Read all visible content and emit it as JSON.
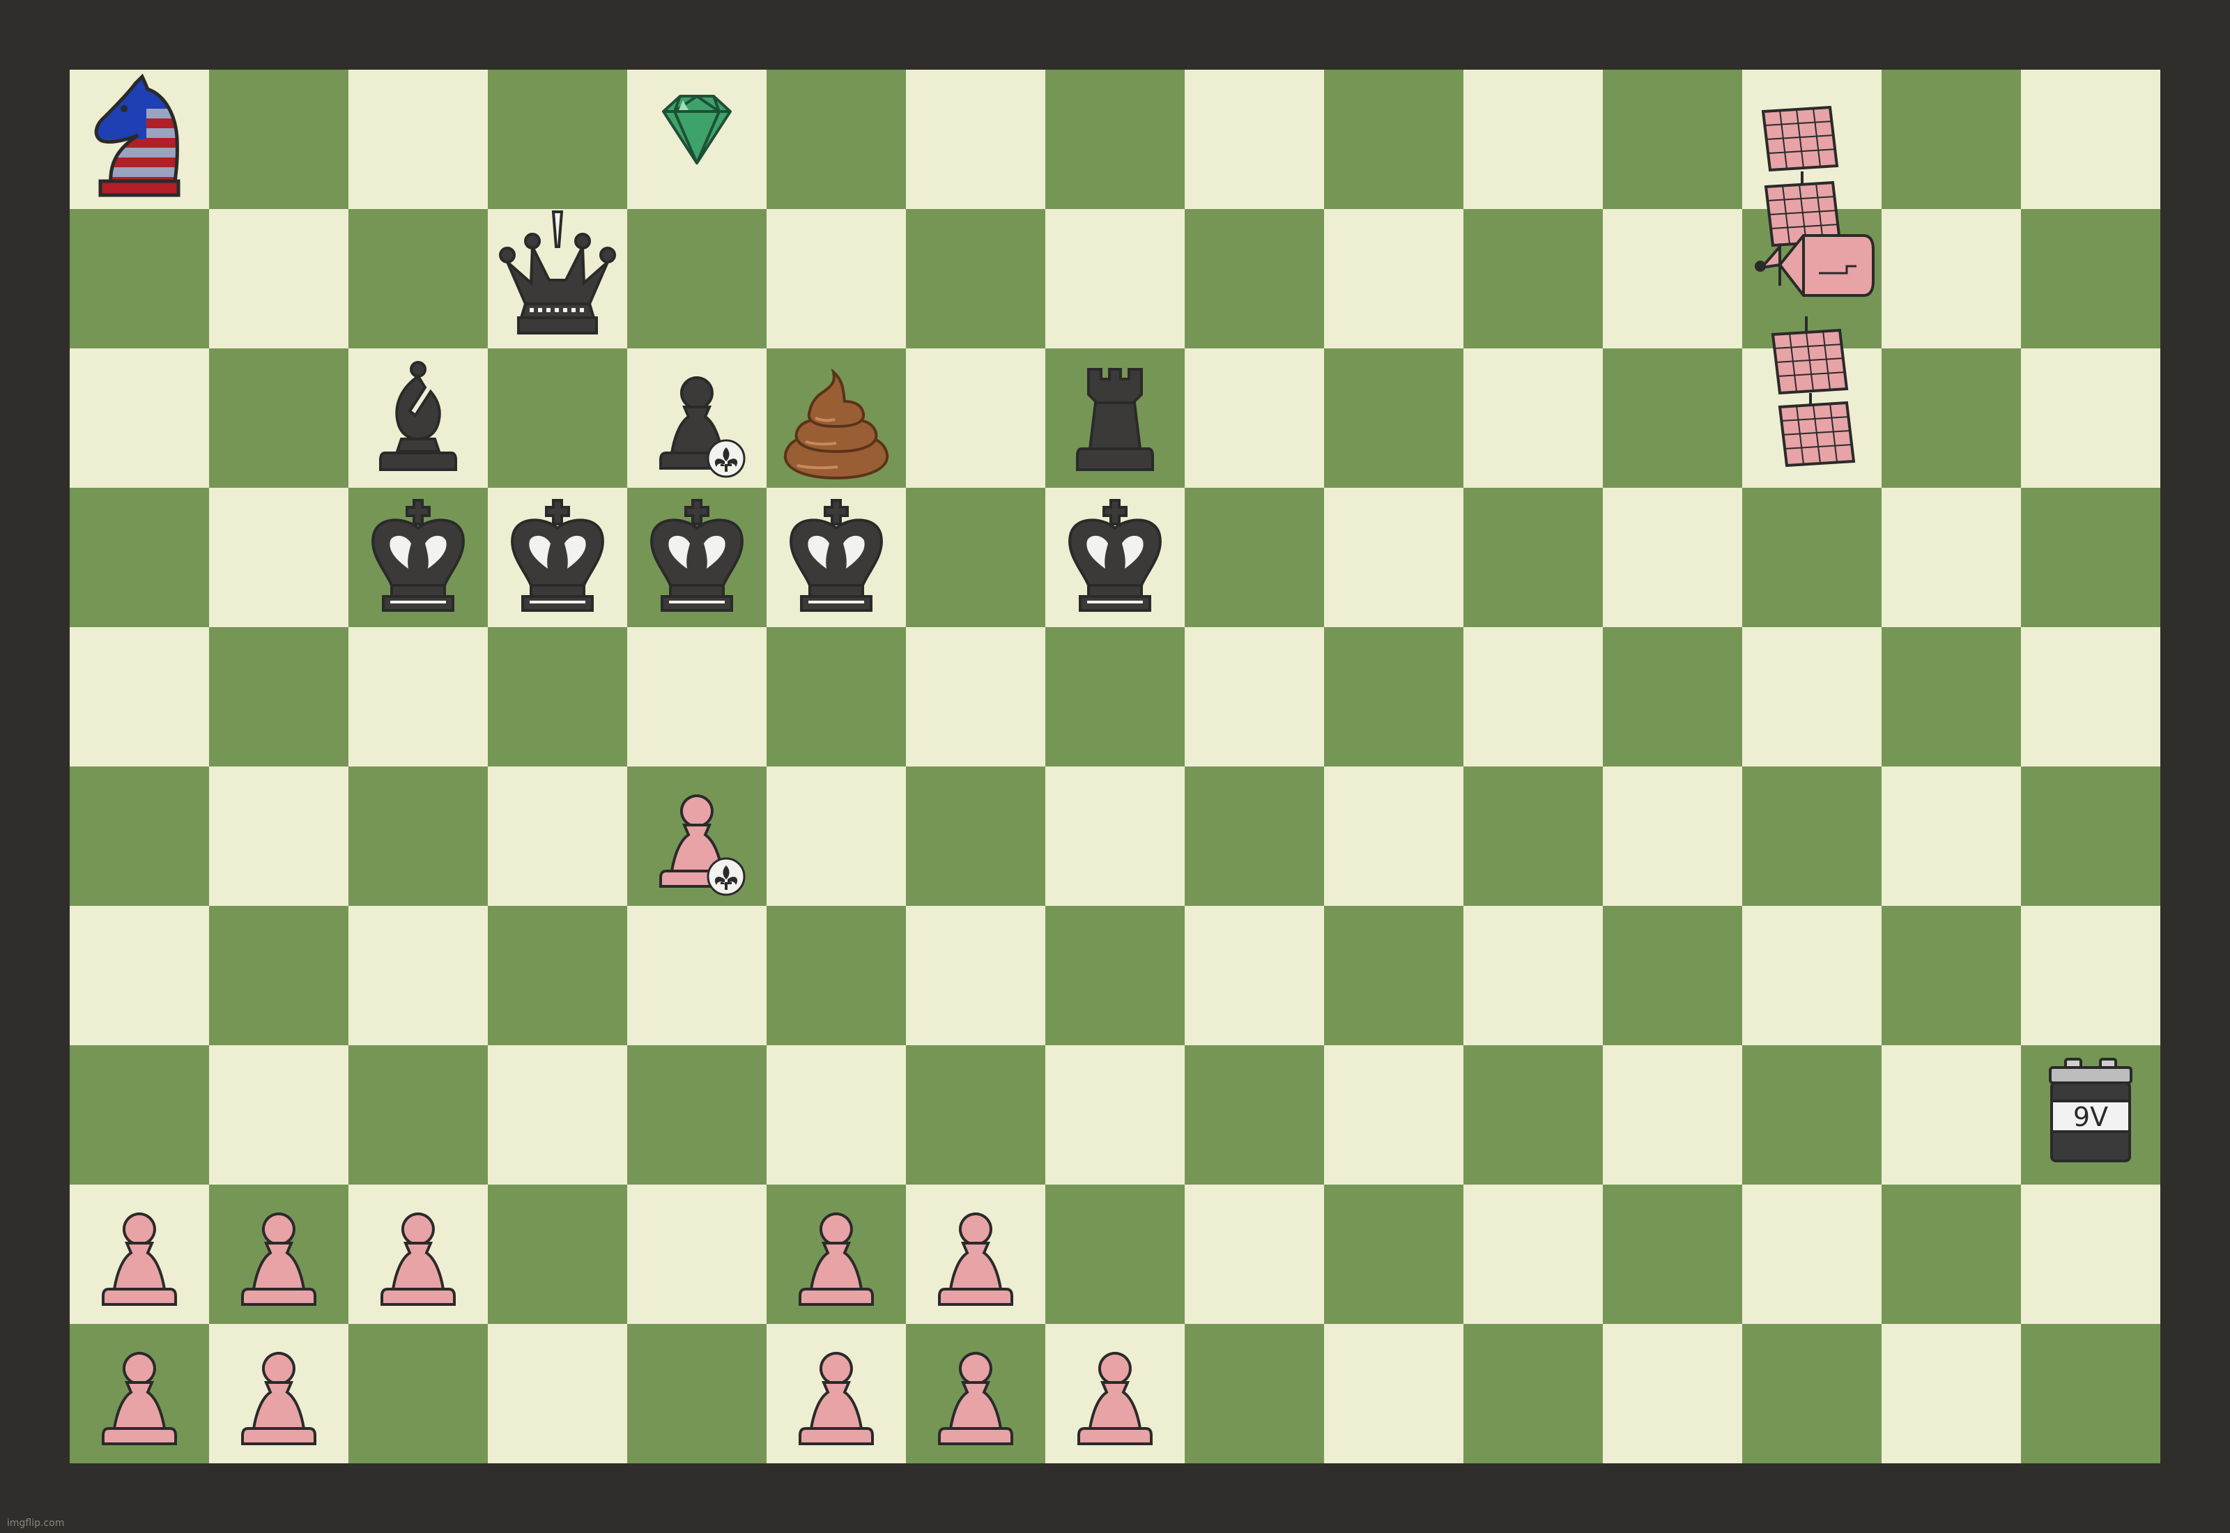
{
  "board": {
    "files": 15,
    "ranks": 10,
    "light_color": "#eeeed2",
    "dark_color": "#769656",
    "first_square_light": true
  },
  "colors": {
    "frame": "#302e2b",
    "black_piece": "#3b3a39",
    "pink_piece": "#e7a3a6",
    "outline": "#2a2a2a"
  },
  "pieces": [
    {
      "name": "knight-american-flag-icon",
      "col": 0,
      "row": 0
    },
    {
      "name": "emerald-gem-icon",
      "col": 4,
      "row": 0
    },
    {
      "name": "black-queen-icon",
      "col": 3,
      "row": 1
    },
    {
      "name": "black-bishop-icon",
      "col": 2,
      "row": 2
    },
    {
      "name": "black-pawn-fleur-de-lis-icon",
      "col": 4,
      "row": 2
    },
    {
      "name": "poop-icon",
      "col": 5,
      "row": 2
    },
    {
      "name": "black-rook-icon",
      "col": 7,
      "row": 2
    },
    {
      "name": "black-king-icon",
      "col": 2,
      "row": 3
    },
    {
      "name": "black-king-icon",
      "col": 3,
      "row": 3
    },
    {
      "name": "black-king-icon",
      "col": 4,
      "row": 3
    },
    {
      "name": "black-king-icon",
      "col": 5,
      "row": 3
    },
    {
      "name": "black-king-icon",
      "col": 7,
      "row": 3
    },
    {
      "name": "pink-pawn-fleur-de-lis-icon",
      "col": 4,
      "row": 5
    },
    {
      "name": "pink-satellite-icon",
      "col": 12,
      "row": 0
    },
    {
      "name": "battery-9v-icon",
      "col": 14,
      "row": 7,
      "label": "9V"
    },
    {
      "name": "pink-pawn-icon",
      "col": 0,
      "row": 8
    },
    {
      "name": "pink-pawn-icon",
      "col": 1,
      "row": 8
    },
    {
      "name": "pink-pawn-icon",
      "col": 2,
      "row": 8
    },
    {
      "name": "pink-pawn-icon",
      "col": 5,
      "row": 8
    },
    {
      "name": "pink-pawn-icon",
      "col": 6,
      "row": 8
    },
    {
      "name": "pink-pawn-icon",
      "col": 0,
      "row": 9
    },
    {
      "name": "pink-pawn-icon",
      "col": 1,
      "row": 9
    },
    {
      "name": "pink-pawn-icon",
      "col": 5,
      "row": 9
    },
    {
      "name": "pink-pawn-icon",
      "col": 6,
      "row": 9
    },
    {
      "name": "pink-pawn-icon",
      "col": 7,
      "row": 9
    }
  ],
  "watermark": "imgflip.com"
}
